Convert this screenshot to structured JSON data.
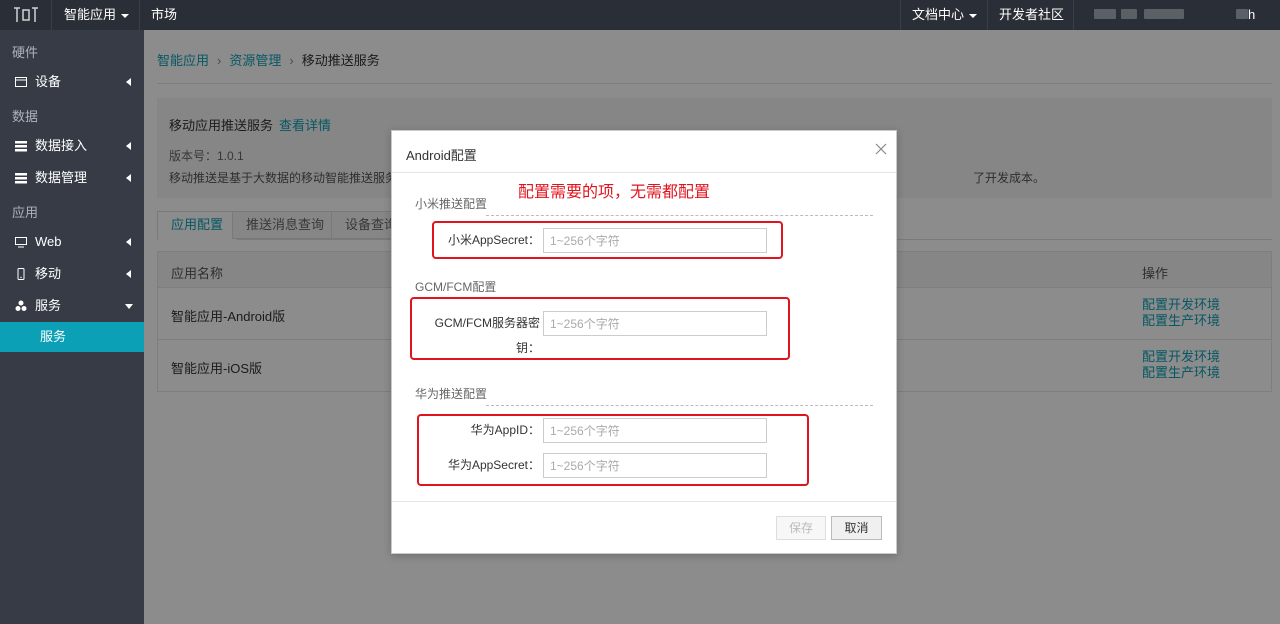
{
  "topbar": {
    "app_menu": "智能应用",
    "market": "市场",
    "docs": "文档中心",
    "community": "开发者社区",
    "user_suffix": "h"
  },
  "sidebar": {
    "group_hardware": "硬件",
    "item_device": "设备",
    "group_data": "数据",
    "item_data_ingest": "数据接入",
    "item_data_manage": "数据管理",
    "group_app": "应用",
    "item_web": "Web",
    "item_mobile": "移动",
    "item_service": "服务",
    "sub_service": "服务"
  },
  "breadcrumb": {
    "b1": "智能应用",
    "b2": "资源管理",
    "b3": "移动推送服务"
  },
  "info": {
    "title": "移动应用推送服务",
    "detail_link": "查看详情",
    "version": "版本号：1.0.1",
    "desc_left": "移动推送是基于大数据的移动智能推送服务",
    "desc_right": "了开发成本。"
  },
  "tabs": [
    "应用配置",
    "推送消息查询",
    "设备查询"
  ],
  "table": {
    "col_name": "应用名称",
    "col_ops": "操作",
    "rows": [
      {
        "name": "智能应用-Android版",
        "op1": "配置开发环境",
        "op2": "配置生产环境"
      },
      {
        "name": "智能应用-iOS版",
        "op1": "配置开发环境",
        "op2": "配置生产环境"
      }
    ]
  },
  "modal": {
    "title": "Android配置",
    "annotation": "配置需要的项，无需都配置",
    "xiaomi_section": "小米推送配置",
    "xiaomi_secret_label": "小米AppSecret：",
    "gcm_section": "GCM/FCM配置",
    "gcm_key_label_1": "GCM/FCM服务器密",
    "gcm_key_label_2": "钥：",
    "huawei_section": "华为推送配置",
    "huawei_appid_label": "华为AppID：",
    "huawei_secret_label": "华为AppSecret：",
    "placeholder": "1~256个字符",
    "save": "保存",
    "cancel": "取消"
  },
  "colors": {
    "accent": "#0ca0b7",
    "sidebar_bg": "#363b45",
    "topbar_bg": "#2a2e36",
    "annotation_red": "#e0141e"
  }
}
